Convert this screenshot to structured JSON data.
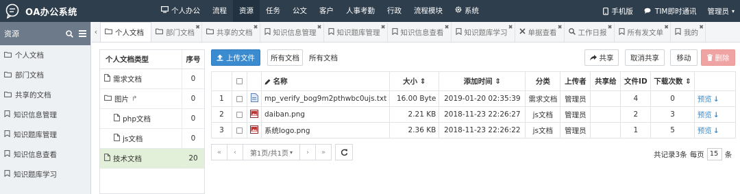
{
  "app": {
    "title": "OA办公系统"
  },
  "topnav": [
    {
      "label": "个人办公",
      "icon": "monitor-icon"
    },
    {
      "label": "流程"
    },
    {
      "label": "资源",
      "active": true
    },
    {
      "label": "任务"
    },
    {
      "label": "公文"
    },
    {
      "label": "客户"
    },
    {
      "label": "人事考勤"
    },
    {
      "label": "行政"
    },
    {
      "label": "流程模块"
    },
    {
      "label": "系统",
      "icon": "gear-icon"
    }
  ],
  "topright": {
    "mobile": "手机版",
    "im": "TIM即时通讯",
    "user": "管理员"
  },
  "sidebar": {
    "title": "资源",
    "items": [
      {
        "label": "个人文档",
        "icon": "folder-icon"
      },
      {
        "label": "部门文档",
        "icon": "folder-icon"
      },
      {
        "label": "共享的文档",
        "icon": "folder-icon"
      },
      {
        "label": "知识信息管理",
        "icon": "bookmark-icon"
      },
      {
        "label": "知识题库管理",
        "icon": "bookmark-icon"
      },
      {
        "label": "知识信息查看",
        "icon": "bookmark-icon"
      },
      {
        "label": "知识题库学习",
        "icon": "bookmark-icon"
      }
    ]
  },
  "tabs": [
    {
      "label": "个人文档",
      "icon": "folder-icon",
      "active": true
    },
    {
      "label": "部门文档",
      "icon": "folder-icon"
    },
    {
      "label": "共享的文档",
      "icon": "folder-icon"
    },
    {
      "label": "知识信息管理",
      "icon": "bookmark-icon"
    },
    {
      "label": "知识题库管理",
      "icon": "bookmark-icon"
    },
    {
      "label": "知识信息查看",
      "icon": "bookmark-icon"
    },
    {
      "label": "知识题库学习",
      "icon": "bookmark-icon"
    },
    {
      "label": "单据查看",
      "icon": "close-icon"
    },
    {
      "label": "工作日报",
      "icon": "search-icon"
    },
    {
      "label": "所有发文单",
      "icon": "bookmark-icon"
    },
    {
      "label": "我的",
      "icon": "bookmark-icon"
    }
  ],
  "types": {
    "header": {
      "name": "个人文档类型",
      "seq": "序号"
    },
    "rows": [
      {
        "name": "需求文档",
        "seq": "0",
        "icon": "file-icon",
        "indent": 0
      },
      {
        "name": "图片",
        "seq": "0",
        "icon": "folder-icon",
        "indent": 0,
        "share": true
      },
      {
        "name": "php文档",
        "seq": "0",
        "icon": "file-icon",
        "indent": 1
      },
      {
        "name": "js文档",
        "seq": "0",
        "icon": "file-icon",
        "indent": 1
      },
      {
        "name": "技术文档",
        "seq": "20",
        "icon": "file-icon",
        "indent": 0,
        "selected": true
      }
    ]
  },
  "toolbar": {
    "upload": "上传文件",
    "all_docs": "所有文档",
    "breadcrumb": "所有文档",
    "share": "共享",
    "unshare": "取消共享",
    "move": "移动",
    "delete": "删除"
  },
  "table": {
    "headers": {
      "name": "名称",
      "size": "大小",
      "time": "添加时间",
      "category": "分类",
      "uploader": "上传者",
      "share_to": "共享给",
      "file_id": "文件ID",
      "downloads": "下载次数"
    },
    "rows": [
      {
        "num": "1",
        "name": "mp_verify_bog9m2pthwbc0ujs.txt",
        "size": "16.00 Byte",
        "time": "2019-01-20 02:35:39",
        "category": "需求文档",
        "uploader": "管理员",
        "share_to": "",
        "file_id": "4",
        "downloads": "0",
        "preview": "预览",
        "type": "txt"
      },
      {
        "num": "2",
        "name": "daiban.png",
        "size": "2.21 KB",
        "time": "2018-11-23 22:26:27",
        "category": "js文档",
        "uploader": "管理员",
        "share_to": "",
        "file_id": "2",
        "downloads": "3",
        "preview": "预览",
        "type": "img"
      },
      {
        "num": "3",
        "name": "系统logo.png",
        "size": "2.36 KB",
        "time": "2018-11-23 22:26:22",
        "category": "js文档",
        "uploader": "管理员",
        "share_to": "",
        "file_id": "1",
        "downloads": "5",
        "preview": "预览",
        "type": "img"
      }
    ]
  },
  "pager": {
    "first": "«",
    "prev": "‹",
    "page": "第1页/共1页",
    "next": "›",
    "last": "»",
    "total": "共记录3条",
    "per_page_label": "每页",
    "per_page": "15",
    "unit": "条"
  }
}
